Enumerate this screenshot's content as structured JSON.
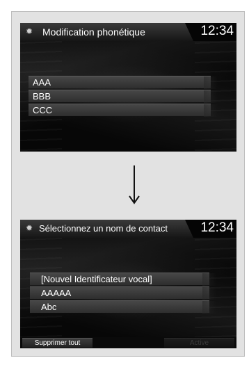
{
  "screen1": {
    "title": "Modification phonétique",
    "clock": "12:34",
    "items": [
      "AAA",
      "BBB",
      "CCC"
    ]
  },
  "screen2": {
    "title": "Sélectionnez un nom de contact",
    "clock": "12:34",
    "items": [
      "[Nouvel Identificateur vocal]",
      "AAAAA",
      "Abc"
    ],
    "buttons": {
      "delete_all": "Supprimer tout",
      "active": "Active"
    }
  },
  "icons": {
    "title": "settings-gear-icon",
    "transition": "arrow-down-icon"
  }
}
